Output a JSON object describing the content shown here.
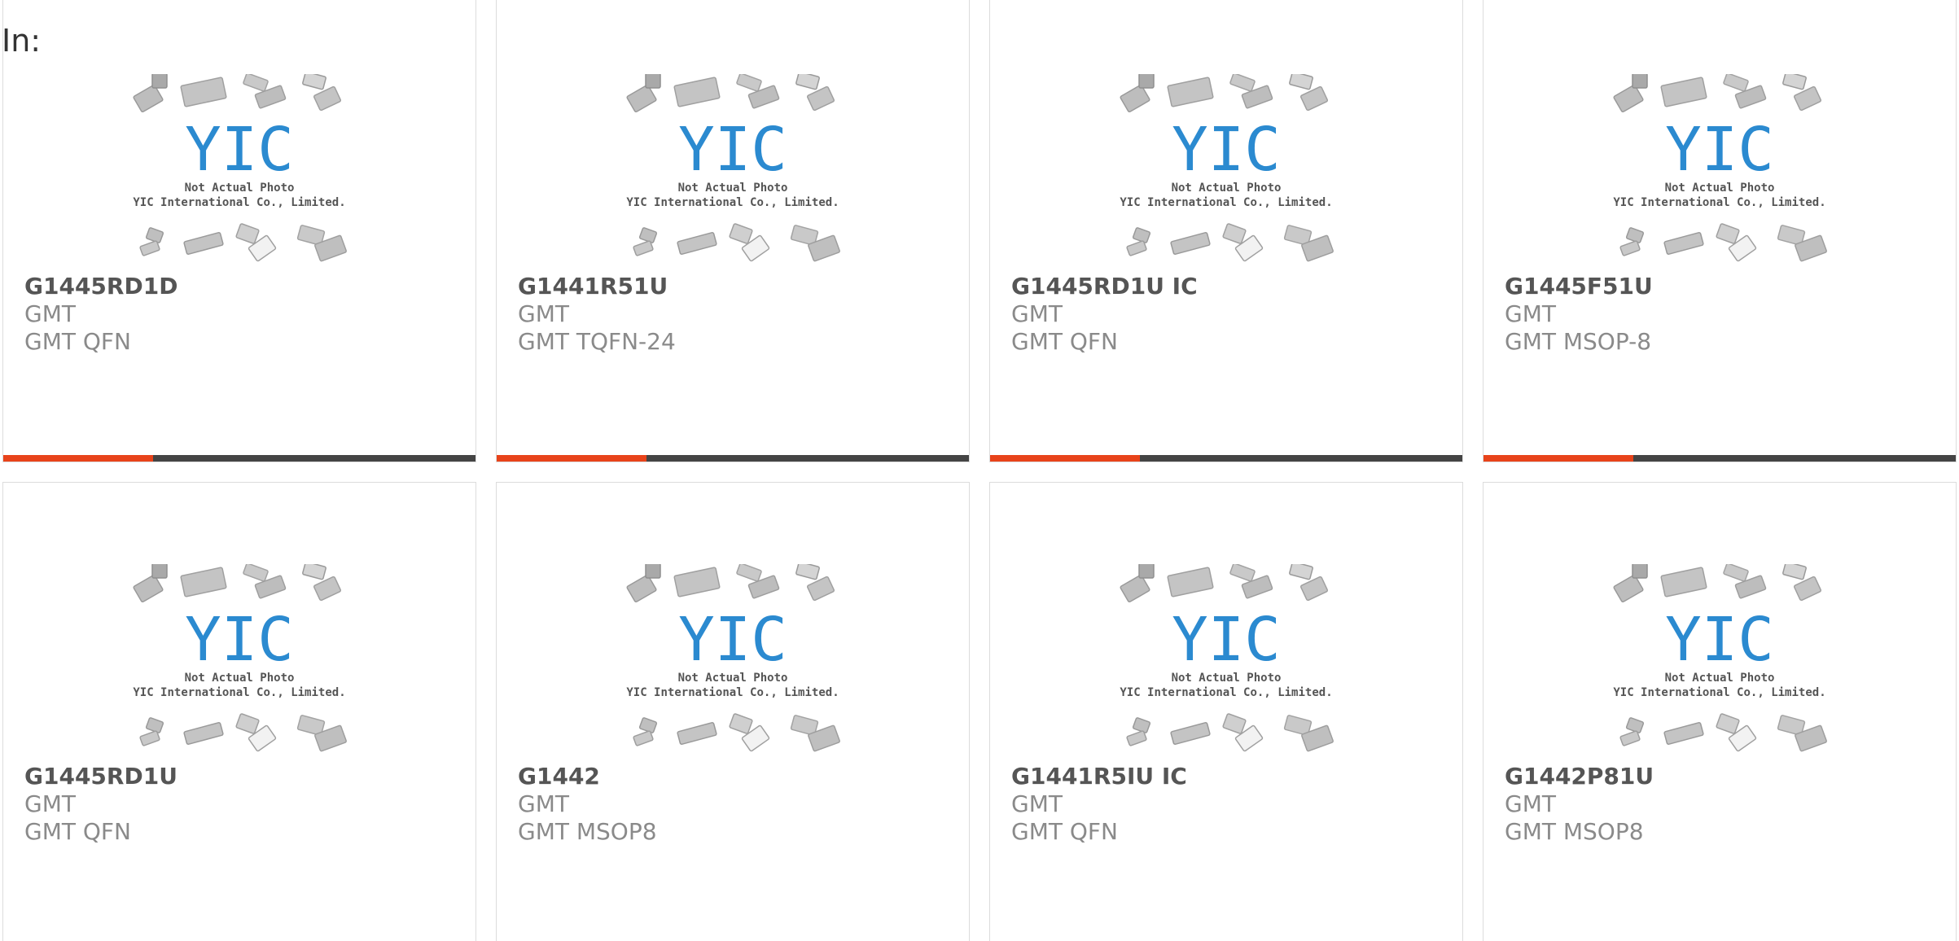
{
  "header": {
    "in_label": "In:"
  },
  "colors": {
    "accent": "#e8431a",
    "bar_dark": "#444444",
    "logo_blue": "#2b8ad0"
  },
  "photo_placeholder": {
    "logo_text": "YIC",
    "line1": "Not Actual Photo",
    "line2": "YIC International Co., Limited."
  },
  "products": [
    {
      "part_number": "G1445RD1D",
      "brand": "GMT",
      "package": "GMT QFN"
    },
    {
      "part_number": "G1441R51U",
      "brand": "GMT",
      "package": "GMT TQFN-24"
    },
    {
      "part_number": "G1445RD1U IC",
      "brand": "GMT",
      "package": "GMT QFN"
    },
    {
      "part_number": "G1445F51U",
      "brand": "GMT",
      "package": "GMT MSOP-8"
    },
    {
      "part_number": "G1445RD1U",
      "brand": "GMT",
      "package": "GMT QFN"
    },
    {
      "part_number": "G1442",
      "brand": "GMT",
      "package": "GMT MSOP8"
    },
    {
      "part_number": "G1441R5IU IC",
      "brand": "GMT",
      "package": "GMT QFN"
    },
    {
      "part_number": "G1442P81U",
      "brand": "GMT",
      "package": "GMT MSOP8"
    }
  ]
}
